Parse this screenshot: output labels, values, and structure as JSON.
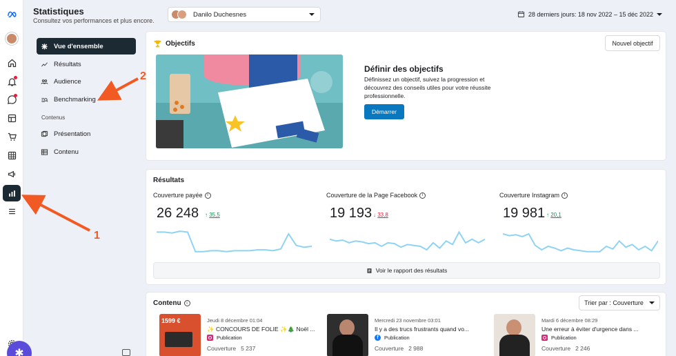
{
  "header": {
    "title": "Statistiques",
    "subtitle": "Consultez vos performances et plus encore.",
    "account_name": "Danilo Duchesnes",
    "date_range": "28 derniers jours: 18 nov 2022 – 15 déc 2022"
  },
  "nav": {
    "items": [
      {
        "label": "Vue d'ensemble",
        "icon": "overview-icon"
      },
      {
        "label": "Résultats",
        "icon": "trend-icon"
      },
      {
        "label": "Audience",
        "icon": "people-icon"
      },
      {
        "label": "Benchmarking",
        "icon": "benchmark-icon"
      }
    ],
    "section": "Contenus",
    "content_items": [
      {
        "label": "Présentation",
        "icon": "presentation-icon"
      },
      {
        "label": "Contenu",
        "icon": "table-icon"
      }
    ]
  },
  "objectives": {
    "title": "Objectifs",
    "new_button": "Nouvel objectif",
    "promo_title": "Définir des objectifs",
    "promo_text": "Définissez un objectif, suivez la progression et découvrez des conseils utiles pour votre réussite professionnelle.",
    "start_button": "Démarrer"
  },
  "results": {
    "title": "Résultats",
    "metrics": [
      {
        "label": "Couverture payée",
        "value": "26 248",
        "change": "35,5",
        "direction": "up",
        "trend": [
          30,
          30,
          29,
          31,
          30,
          8,
          8,
          9,
          9,
          8,
          9,
          9,
          9,
          10,
          10,
          9,
          11,
          28,
          15,
          13,
          14
        ]
      },
      {
        "label": "Couverture de la Page Facebook",
        "value": "19 193",
        "change": "33,8",
        "direction": "down",
        "trend": [
          22,
          20,
          21,
          18,
          20,
          19,
          17,
          18,
          14,
          18,
          17,
          13,
          16,
          15,
          14,
          10,
          18,
          12,
          20,
          16,
          30,
          18,
          22,
          18,
          22
        ]
      },
      {
        "label": "Couverture Instagram",
        "value": "19 981",
        "change": "20,1",
        "direction": "up",
        "trend": [
          28,
          26,
          27,
          25,
          28,
          15,
          10,
          14,
          12,
          9,
          12,
          10,
          9,
          8,
          8,
          8,
          14,
          11,
          20,
          13,
          16,
          10,
          14,
          9,
          20
        ]
      }
    ],
    "report_button": "Voir le rapport des résultats"
  },
  "content": {
    "title": "Contenu",
    "sort_label": "Trier par : Couverture",
    "posts": [
      {
        "date": "Jeudi 8 décembre 01:04",
        "text": "✨ CONCOURS DE FOLIE ✨🎄 Noël ...",
        "type": "Publication",
        "platform": "instagram",
        "reach_label": "Couverture",
        "reach": "5 237",
        "thumb_text": "1599 €"
      },
      {
        "date": "Mercredi 23 novembre 03:01",
        "text": "Il y a des trucs frustrants quand vo...",
        "type": "Publication",
        "platform": "facebook",
        "reach_label": "Couverture",
        "reach": "2 988"
      },
      {
        "date": "Mardi 6 décembre 08:29",
        "text": "Une erreur à éviter d'urgence dans ...",
        "type": "Publication",
        "platform": "instagram",
        "reach_label": "Couverture",
        "reach": "2 246"
      }
    ]
  },
  "annotations": [
    "1",
    "2"
  ],
  "colors": {
    "accent": "#0a78be",
    "nav_active": "#1c2b33",
    "arrow": "#f15a22",
    "up": "#198754",
    "down": "#e41e3f",
    "spark": "#8fd3f4"
  }
}
